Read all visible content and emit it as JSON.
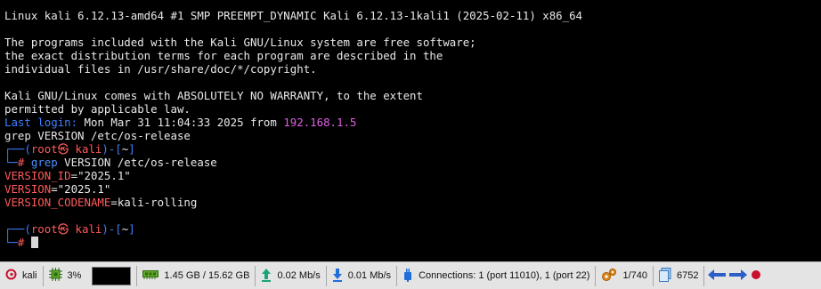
{
  "terminal": {
    "uname": "Linux kali 6.12.13-amd64 #1 SMP PREEMPT_DYNAMIC Kali 6.12.13-1kali1 (2025-02-11) x86_64",
    "motd1": "The programs included with the Kali GNU/Linux system are free software;",
    "motd2": "the exact distribution terms for each program are described in the",
    "motd3": "individual files in /usr/share/doc/*/copyright.",
    "warranty1": "Kali GNU/Linux comes with ABSOLUTELY NO WARRANTY, to the extent",
    "warranty2": "permitted by applicable law.",
    "last_login_label": "Last login:",
    "last_login_time": " Mon Mar 31 11:04:33 2025 from ",
    "last_login_ip": "192.168.1.5",
    "typed_cmd": "grep VERSION /etc/os-release",
    "prompt_top_prefix": "┌──(",
    "prompt_user": "root",
    "prompt_at": "㉿",
    "prompt_host": "kali",
    "prompt_mid": ")-[",
    "prompt_dir": "~",
    "prompt_end": "]",
    "prompt_bottom": "└─",
    "prompt_hash": "#",
    "cmd_name": "grep",
    "cmd_args": " VERSION /etc/os-release",
    "out1_key": "VERSION_ID",
    "out1_val": "=\"2025.1\"",
    "out2_key": "VERSION",
    "out2_val": "=\"2025.1\"",
    "out3_key": "VERSION_CODENAME",
    "out3_val": "=kali-rolling"
  },
  "statusbar": {
    "session": "kali",
    "cpu": "3%",
    "memory": "1.45 GB / 15.62 GB",
    "upload": "0.02 Mb/s",
    "download": "0.01 Mb/s",
    "connections": "Connections: 1 (port 11010), 1 (port 22)",
    "processes": "1/740",
    "files": "6752"
  }
}
